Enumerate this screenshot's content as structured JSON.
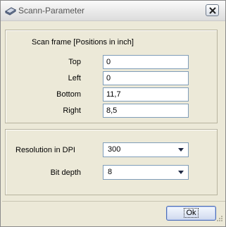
{
  "window": {
    "title": "Scann-Parameter"
  },
  "scan_frame": {
    "group_label": "Scan frame [Positions in inch]",
    "fields": [
      {
        "label": "Top",
        "value": "0"
      },
      {
        "label": "Left",
        "value": "0"
      },
      {
        "label": "Bottom",
        "value": "11,7"
      },
      {
        "label": "Right",
        "value": "8,5"
      }
    ]
  },
  "settings": {
    "resolution_label": "Resolution in DPI",
    "resolution_value": "300",
    "bit_depth_label": "Bit depth",
    "bit_depth_value": "8"
  },
  "buttons": {
    "ok_label": "Ok"
  },
  "icons": {
    "title_icon": "scanner-icon",
    "close_icon": "close-icon",
    "combo_arrow": "chevron-down-icon"
  }
}
